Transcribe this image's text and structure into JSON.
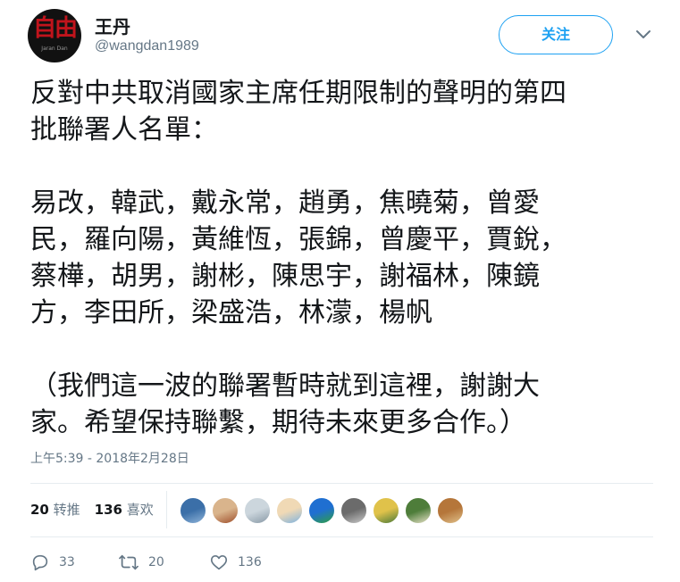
{
  "author": {
    "display_name": "王丹",
    "handle": "@wangdan1989",
    "avatar_text": "自由",
    "avatar_caption": "Jaran Dan"
  },
  "follow_button": {
    "label": "关注"
  },
  "tweet": {
    "text": "反對中共取消國家主席任期限制的聲明的第四\n批聯署人名單：\n\n易改，韓武，戴永常，趙勇，焦曉菊，曾愛\n民，羅向陽，黃維恆，張錦，曾慶平，賈銳，\n蔡樺，胡男，謝彬，陳思宇，謝福林，陳鏡\n方，李田所，梁盛浩，林濛，楊帆\n\n（我們這一波的聯署暫時就到這裡，謝謝大\n家。希望保持聯繫，期待未來更多合作。）",
    "timestamp": "上午5:39 - 2018年2月28日"
  },
  "stats": {
    "retweets_count": "20",
    "retweets_label": "转推",
    "likes_count": "136",
    "likes_label": "喜欢"
  },
  "liker_avatars": [
    {
      "name": "liker-1",
      "colors": [
        "#3b6fa8",
        "#8fb4d9"
      ]
    },
    {
      "name": "liker-2",
      "colors": [
        "#d9b48c",
        "#a0502c"
      ]
    },
    {
      "name": "liker-3",
      "colors": [
        "#ccd6dd",
        "#8899a6"
      ]
    },
    {
      "name": "liker-4",
      "colors": [
        "#f0d9b5",
        "#7fb3e0"
      ]
    },
    {
      "name": "liker-5",
      "colors": [
        "#1f6fd1",
        "#2ea043"
      ]
    },
    {
      "name": "liker-6",
      "colors": [
        "#6b6b6b",
        "#c9c9c9"
      ]
    },
    {
      "name": "liker-7",
      "colors": [
        "#e0c24a",
        "#4a7a3a"
      ]
    },
    {
      "name": "liker-8",
      "colors": [
        "#4e7d3a",
        "#e8e2c8"
      ]
    },
    {
      "name": "liker-9",
      "colors": [
        "#b5763a",
        "#e0c08a"
      ]
    }
  ],
  "actions": {
    "replies_count": "33",
    "retweets_count": "20",
    "likes_count": "136"
  },
  "colors": {
    "accent": "#1da1f2",
    "secondary_text": "#657786",
    "primary_text": "#14171a"
  }
}
